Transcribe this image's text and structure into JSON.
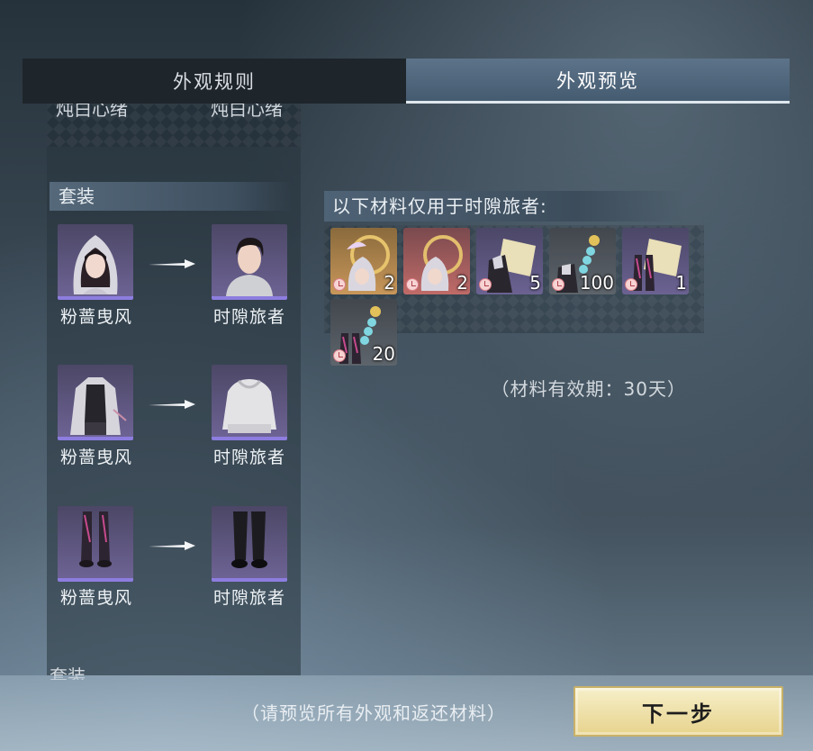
{
  "tabs": {
    "rules": "外观规则",
    "preview": "外观预览",
    "active": "preview"
  },
  "left": {
    "cut_top_labels": [
      "炖白心绪",
      "炖白心绪"
    ],
    "section_title": "套装",
    "pairs": [
      {
        "from": "粉蔷曳风",
        "to": "时隙旅者",
        "slot": "hood"
      },
      {
        "from": "粉蔷曳风",
        "to": "时隙旅者",
        "slot": "jacket"
      },
      {
        "from": "粉蔷曳风",
        "to": "时隙旅者",
        "slot": "boots"
      }
    ],
    "cut_bottom_title": "套装"
  },
  "materials": {
    "header": "以下材料仅用于时隙旅者:",
    "items": [
      {
        "icon": "ring-hood-icon",
        "quantity": "2",
        "rarity": "orange",
        "color": "#c8975a"
      },
      {
        "icon": "ring-hood-icon",
        "quantity": "2",
        "rarity": "red",
        "color": "#c06b68"
      },
      {
        "icon": "book-jacket-icon",
        "quantity": "5",
        "rarity": "purple",
        "color": "#6b6292"
      },
      {
        "icon": "tassel-jacket-icon",
        "quantity": "100",
        "rarity": "gray",
        "color": "#5d646b"
      },
      {
        "icon": "book-boots-icon",
        "quantity": "1",
        "rarity": "purple",
        "color": "#6b6292"
      },
      {
        "icon": "tassel-boots-icon",
        "quantity": "20",
        "rarity": "gray",
        "color": "#5d646b"
      }
    ],
    "validity": "（材料有效期：30天）"
  },
  "footer": {
    "hint": "（请预览所有外观和返还材料）",
    "next_button": "下一步"
  }
}
